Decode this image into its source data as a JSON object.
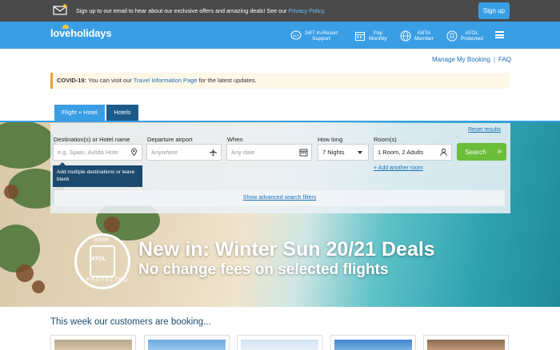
{
  "topbar": {
    "message": "Sign up to our email to hear about our exclusive offers and amazing deals! See our ",
    "privacy_link": "Privacy Policy.",
    "signup_label": "Sign up"
  },
  "header": {
    "logo": "loveholidays",
    "items": [
      {
        "icon": "chat-support-icon",
        "line1": "24/7 In-Resort",
        "line2": "Support"
      },
      {
        "icon": "calendar-icon",
        "line1": "Pay",
        "line2": "Monthly"
      },
      {
        "icon": "globe-icon",
        "line1": "ABTA",
        "line2": "Member"
      },
      {
        "icon": "atol-shield-icon",
        "line1": "ATOL",
        "line2": "Protected"
      }
    ]
  },
  "links": {
    "manage": "Manage My Booking",
    "faq": "FAQ"
  },
  "covid": {
    "label": "COVID-19:",
    "text_before": " You can visit our ",
    "link": "Travel Information Page",
    "text_after": " for the latest updates."
  },
  "tabs": [
    {
      "label": "Flight + Hotel",
      "active": true
    },
    {
      "label": "Hotels",
      "active": false
    }
  ],
  "search": {
    "reset": "Reset results",
    "destination_label": "Destination(s) or Hotel name",
    "destination_placeholder": "e.g. Spain, Avlida Hote",
    "departure_label": "Departure airport",
    "departure_placeholder": "Anywhere",
    "when_label": "When",
    "when_placeholder": "Any date",
    "howlong_label": "How long",
    "howlong_value": "7 Nights",
    "rooms_label": "Room(s)",
    "rooms_value": "1 Room, 2 Adults",
    "search_button": "Search",
    "tooltip": "Add multiple destinations or leave blank",
    "add_another": "+ Add another room",
    "advanced": "Show advanced search filters"
  },
  "promo": {
    "line1": "New in: Winter Sun 20/21 Deals",
    "line2": "No change fees on selected flights",
    "atol_number": "10589",
    "atol_text": "ATOL",
    "atol_protected": "PROTECTED"
  },
  "booking_heading": "This week our customers are booking...",
  "colors": {
    "brand_blue": "#3a9ee4",
    "dark_bar": "#4a4a4a",
    "search_green": "#6bbd3a"
  }
}
